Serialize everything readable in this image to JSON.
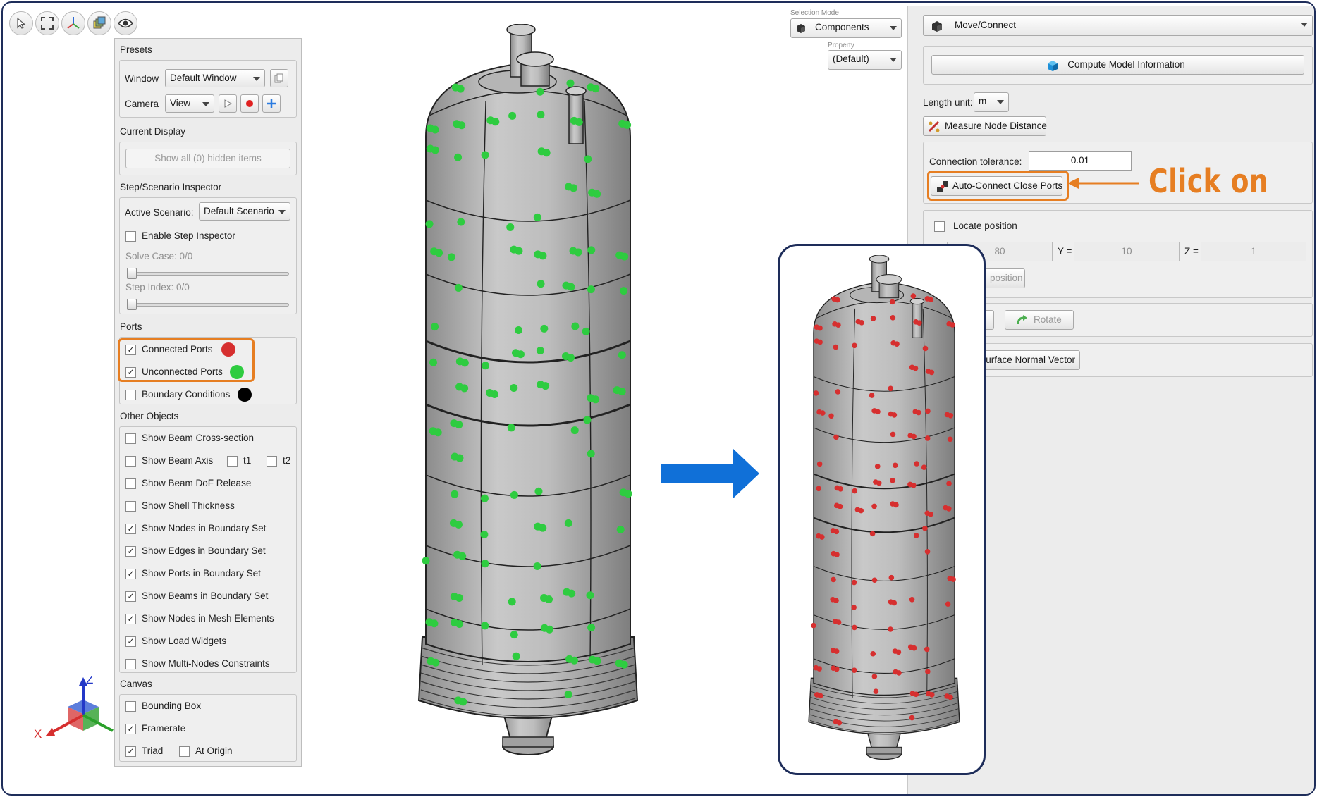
{
  "presets": {
    "title": "Presets",
    "window_label": "Window",
    "window_value": "Default Window",
    "camera_label": "Camera",
    "camera_value": "View"
  },
  "current_display": {
    "title": "Current Display",
    "show_hidden_button": "Show all (0) hidden items"
  },
  "step_inspector": {
    "title": "Step/Scenario Inspector",
    "active_scenario_label": "Active Scenario:",
    "active_scenario_value": "Default Scenario",
    "enable_label": "Enable Step Inspector",
    "solve_case_label": "Solve Case: 0/0",
    "step_index_label": "Step Index: 0/0"
  },
  "ports": {
    "title": "Ports",
    "items": [
      {
        "label": "Connected Ports",
        "checked": true,
        "color": "#d62f2f"
      },
      {
        "label": "Unconnected Ports",
        "checked": true,
        "color": "#2ecc40"
      },
      {
        "label": "Boundary Conditions",
        "checked": false,
        "color": "#000000"
      }
    ]
  },
  "other_objects": {
    "title": "Other Objects",
    "items": [
      {
        "label": "Show Beam Cross-section",
        "checked": false
      },
      {
        "label": "Show Beam Axis",
        "checked": false
      },
      {
        "label": "Show Beam DoF Release",
        "checked": false
      },
      {
        "label": "Show Shell Thickness",
        "checked": false
      },
      {
        "label": "Show Nodes in Boundary Set",
        "checked": true
      },
      {
        "label": "Show Edges in Boundary Set",
        "checked": true
      },
      {
        "label": "Show Ports in Boundary Set",
        "checked": true
      },
      {
        "label": "Show Beams in Boundary Set",
        "checked": true
      },
      {
        "label": "Show Nodes in Mesh Elements",
        "checked": true
      },
      {
        "label": "Show Load Widgets",
        "checked": true
      },
      {
        "label": "Show Multi-Nodes Constraints",
        "checked": false
      }
    ],
    "t1_label": "t1",
    "t2_label": "t2"
  },
  "canvas": {
    "title": "Canvas",
    "items": [
      {
        "label": "Bounding Box",
        "checked": false
      },
      {
        "label": "Framerate",
        "checked": true
      },
      {
        "label": "Triad",
        "checked": true
      }
    ],
    "at_origin_label": "At Origin"
  },
  "triad": {
    "x": "X",
    "z": "Z"
  },
  "selection": {
    "mode_caption": "Selection Mode",
    "mode_value": "Components",
    "property_caption": "Property",
    "property_value": "(Default)"
  },
  "right_panel": {
    "tool_value": "Move/Connect",
    "compute_button": "Compute Model Information",
    "length_unit_label": "Length unit:",
    "length_unit_value": "m",
    "measure_button": "Measure Node Distance",
    "tolerance_label": "Connection tolerance:",
    "tolerance_value": "0.01",
    "auto_connect_button": "Auto-Connect Close Ports",
    "locate_label": "Locate position",
    "x_value": "80",
    "y_label": "Y =",
    "y_value": "10",
    "z_label": "Z =",
    "z_value": "1",
    "position_fragment": "position",
    "rotate_button": "Rotate",
    "normal_fragment": "y Surface Normal Vector"
  },
  "annotation": {
    "text": "Click on",
    "color": "#e67e22"
  },
  "colors": {
    "arrow": "#1070d8",
    "frame": "#1e2d5a",
    "highlight": "#e67e22",
    "unconnected": "#2ecc40",
    "connected": "#d62f2f"
  }
}
